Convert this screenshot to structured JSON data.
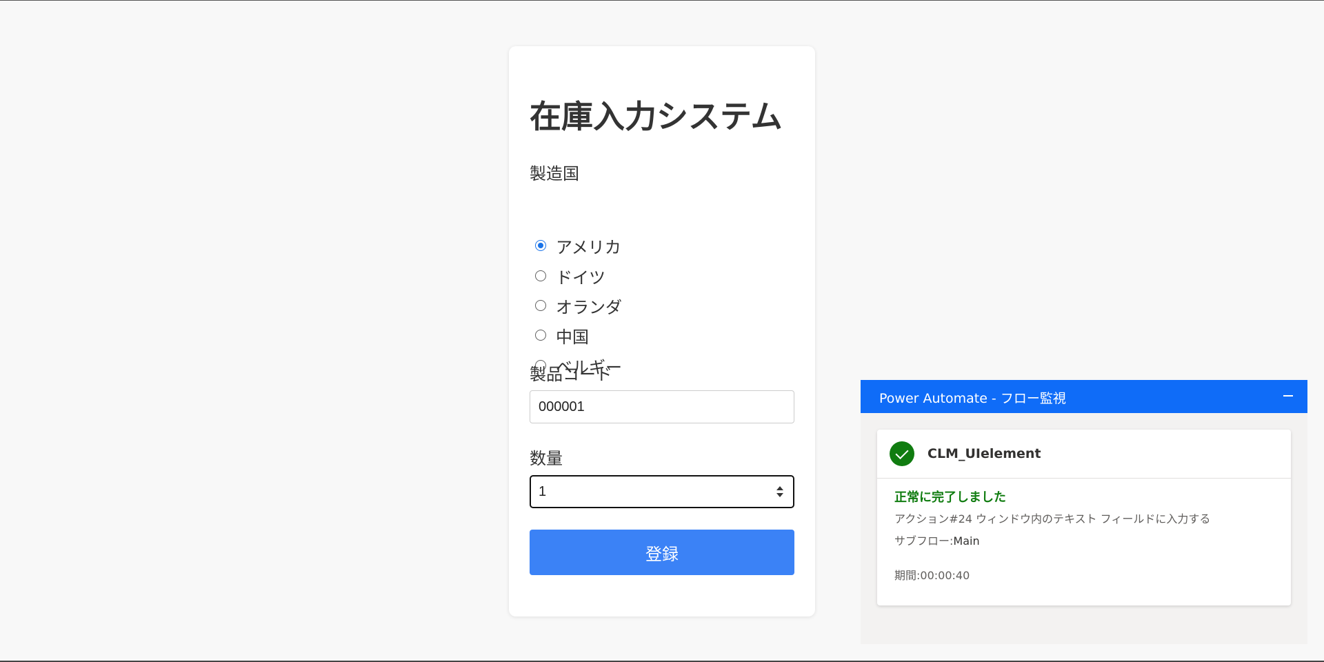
{
  "form": {
    "title": "在庫入力システム",
    "country_label": "製造国",
    "countries": [
      {
        "label": "アメリカ",
        "checked": true
      },
      {
        "label": "ドイツ",
        "checked": false
      },
      {
        "label": "オランダ",
        "checked": false
      },
      {
        "label": "中国",
        "checked": false
      },
      {
        "label": "ベルギー",
        "checked": false
      }
    ],
    "product_code_label": "製品コード",
    "product_code_value": "000001",
    "quantity_label": "数量",
    "quantity_value": "1",
    "submit_label": "登録"
  },
  "power_automate": {
    "window_title": "Power Automate - フロー監視",
    "flow_name": "CLM_UIelement",
    "status": "正常に完了しました",
    "action_text": "アクション#24 ウィンドウ内のテキスト フィールドに入力する",
    "subflow_label": "サブフロー:",
    "subflow_value": "Main",
    "duration_label": "期間:",
    "duration_value": "00:00:40",
    "status_color": "#107c10",
    "header_color": "#0f6cf8"
  }
}
